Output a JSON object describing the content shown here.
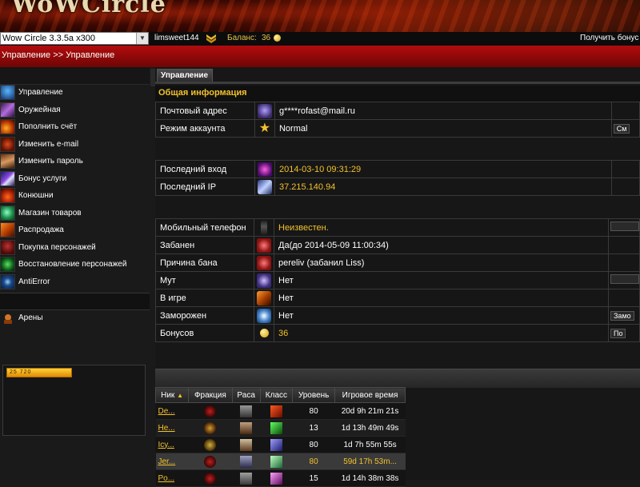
{
  "header": {
    "logo_text": "WoWCircle",
    "server_select": "Wow Circle 3.3.5a x300",
    "username": "limsweet144",
    "balance_label": "Баланс:",
    "balance_value": "36",
    "get_bonus_link": "Получить бонус"
  },
  "breadcrumb": "Управление >> Управление",
  "sidebar": {
    "items": [
      {
        "label": "Управление",
        "icon": "management-icon"
      },
      {
        "label": "Оружейная",
        "icon": "armory-icon"
      },
      {
        "label": "Пополнить счёт",
        "icon": "top-up-icon"
      },
      {
        "label": "Изменить e-mail",
        "icon": "change-email-icon"
      },
      {
        "label": "Изменить пароль",
        "icon": "change-password-icon"
      },
      {
        "label": "Бонус услуги",
        "icon": "bonus-services-icon"
      },
      {
        "label": "Конюшни",
        "icon": "stables-icon"
      },
      {
        "label": "Магазин товаров",
        "icon": "shop-icon"
      },
      {
        "label": "Распродажа",
        "icon": "sale-icon"
      },
      {
        "label": "Покупка персонажей",
        "icon": "buy-characters-icon"
      },
      {
        "label": "Восстановление персонажей",
        "icon": "restore-characters-icon"
      },
      {
        "label": "AntiError",
        "icon": "antierror-icon"
      }
    ],
    "arena_label": "Арены",
    "widget_counter": "25 720"
  },
  "main": {
    "tab_label": "Управление",
    "section_title": "Общая информация",
    "account_rows": [
      {
        "label": "Почтовый адрес",
        "value": "g****rofast@mail.ru",
        "icon": "mail-icon"
      },
      {
        "label": "Режим аккаунта",
        "value": "Normal",
        "icon": "star-icon",
        "button": "См"
      }
    ],
    "login_rows": [
      {
        "label": "Последний вход",
        "value": "2014-03-10 09:31:29",
        "icon": "last-login-icon"
      },
      {
        "label": "Последний IP",
        "value": "37.215.140.94",
        "icon": "ip-icon"
      }
    ],
    "status_rows": [
      {
        "label": "Мобильный телефон",
        "value": "Неизвестен.",
        "icon": "phone-icon"
      },
      {
        "label": "Забанен",
        "value": "Да(до 2014-05-09 11:00:34)",
        "icon": "ban-icon"
      },
      {
        "label": "Причина бана",
        "value": "pereliv (забанил Liss)",
        "icon": "ban-reason-icon"
      },
      {
        "label": "Мут",
        "value": "Нет",
        "icon": "mute-icon"
      },
      {
        "label": "В игре",
        "value": "Нет",
        "icon": "ingame-icon"
      },
      {
        "label": "Заморожен",
        "value": "Нет",
        "icon": "frozen-icon",
        "button": "Замо"
      },
      {
        "label": "Бонусов",
        "value": "36",
        "icon": "coin-icon",
        "button": "По"
      }
    ],
    "characters": {
      "headers": [
        "Ник",
        "Фракция",
        "Раса",
        "Класс",
        "Уровень",
        "Игровое время"
      ],
      "rows": [
        {
          "name": "De...",
          "level": "80",
          "time": "20d 9h 21m 21s"
        },
        {
          "name": "He...",
          "level": "13",
          "time": "1d 13h 49m 49s"
        },
        {
          "name": "Icy...",
          "level": "80",
          "time": "1d 7h 55m 55s"
        },
        {
          "name": "Jer...",
          "level": "80",
          "time": "59d 17h 53m..."
        },
        {
          "name": "Po...",
          "level": "15",
          "time": "1d 14h 38m 38s"
        }
      ]
    }
  },
  "colors": {
    "accent": "#f3c22d",
    "crumb_red": "#b30c0c",
    "bg": "#1a1a1a"
  }
}
